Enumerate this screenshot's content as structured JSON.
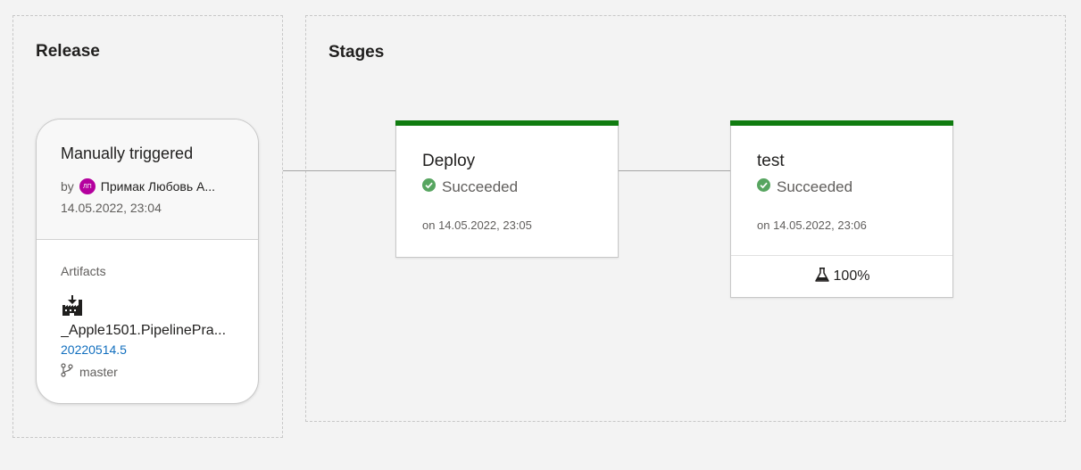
{
  "release": {
    "section_title": "Release",
    "trigger_title": "Manually triggered",
    "by_label": "by",
    "avatar_initials": "ЛП",
    "avatar_color": "#b4009e",
    "user_name": "Примак Любовь А...",
    "date": "14.05.2022, 23:04",
    "artifacts_label": "Artifacts",
    "artifact_icon": "build-artifact-icon",
    "artifact_name": "_Apple1501.PipelinePra...",
    "artifact_version": "20220514.5",
    "branch_icon": "branch-icon",
    "branch": "master"
  },
  "stages": {
    "section_title": "Stages",
    "items": [
      {
        "name": "Deploy",
        "status": "Succeeded",
        "status_icon": "success-check-icon",
        "date": "on 14.05.2022, 23:05"
      },
      {
        "name": "test",
        "status": "Succeeded",
        "status_icon": "success-check-icon",
        "date": "on 14.05.2022, 23:06",
        "test_icon": "flask-icon",
        "test_pass_rate": "100%"
      }
    ]
  },
  "colors": {
    "success": "#107c10",
    "success_icon": "#57a560",
    "link": "#106ebe",
    "background": "#f3f3f3"
  }
}
